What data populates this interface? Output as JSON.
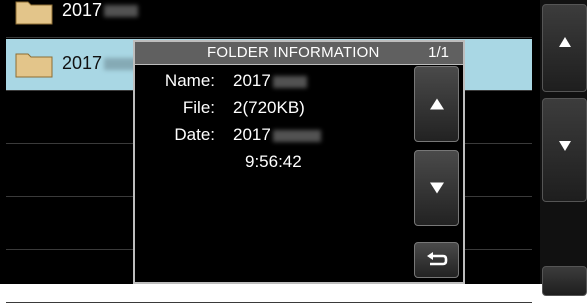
{
  "folders": [
    {
      "label": "2017"
    },
    {
      "label": "2017",
      "selected": true
    },
    {
      "label": ""
    },
    {
      "label": ""
    },
    {
      "label": ""
    },
    {
      "label": ""
    }
  ],
  "dialog": {
    "title": "FOLDER INFORMATION",
    "page": "1/1",
    "fields": [
      {
        "label": "Name:",
        "value": "2017"
      },
      {
        "label": "File:",
        "value": "2(720KB)"
      },
      {
        "label": "Date:",
        "value": "2017"
      },
      {
        "label": "",
        "value": "9:56:42"
      }
    ],
    "buttons": {
      "up": "up-arrow-icon",
      "down": "down-arrow-icon",
      "return": "return-icon"
    }
  },
  "colors": {
    "selected_row": "#a9d7e4",
    "folder_icon": "#e3c58a"
  }
}
